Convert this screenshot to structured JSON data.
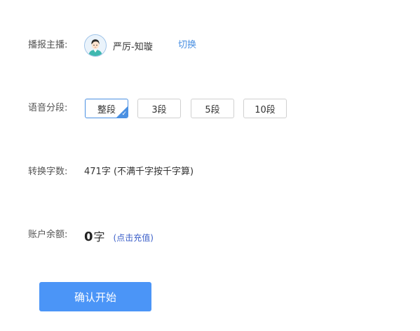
{
  "anchor": {
    "label": "播报主播:",
    "name": "严厉-知璇",
    "switch_label": "切换"
  },
  "segments": {
    "label": "语音分段:",
    "options": [
      "整段",
      "3段",
      "5段",
      "10段"
    ],
    "selected": "整段"
  },
  "count": {
    "label": "转换字数:",
    "value": "471字 (不满千字按千字算)"
  },
  "balance": {
    "label": "账户余额:",
    "value": "0",
    "unit": "字",
    "recharge_label": "(点击充值)"
  },
  "confirm_label": "确认开始",
  "colors": {
    "accent": "#4a90e2",
    "button_bg": "#4b95f7",
    "recharge": "#3b5fc9"
  }
}
